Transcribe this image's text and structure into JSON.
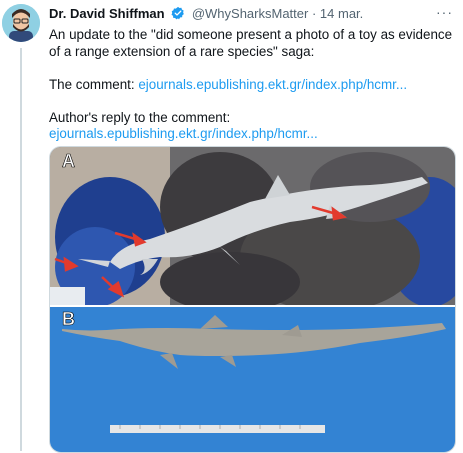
{
  "tweet": {
    "author_name": "Dr. David Shiffman",
    "handle": "@WhySharksMatter",
    "separator": "·",
    "date": "14 mar.",
    "more_label": "···",
    "text_line1": "An update to the \"did someone present a photo of a toy as evidence of a range extension of a rare species\" saga:",
    "comment_label": "The comment:",
    "comment_link": "ejournals.epublishing.ekt.gr/index.php/hcmr...",
    "reply_label": "Author's reply to the comment:",
    "reply_link": "ejournals.epublishing.ekt.gr/index.php/hcmr..."
  },
  "media": {
    "panel_a_label": "A",
    "panel_b_label": "B"
  },
  "colors": {
    "link": "#1d9bf0",
    "verified": "#1d9bf0",
    "panel_b_background": "#2f7fd0"
  },
  "icons": [
    "verified-badge-icon",
    "more-options-icon"
  ]
}
